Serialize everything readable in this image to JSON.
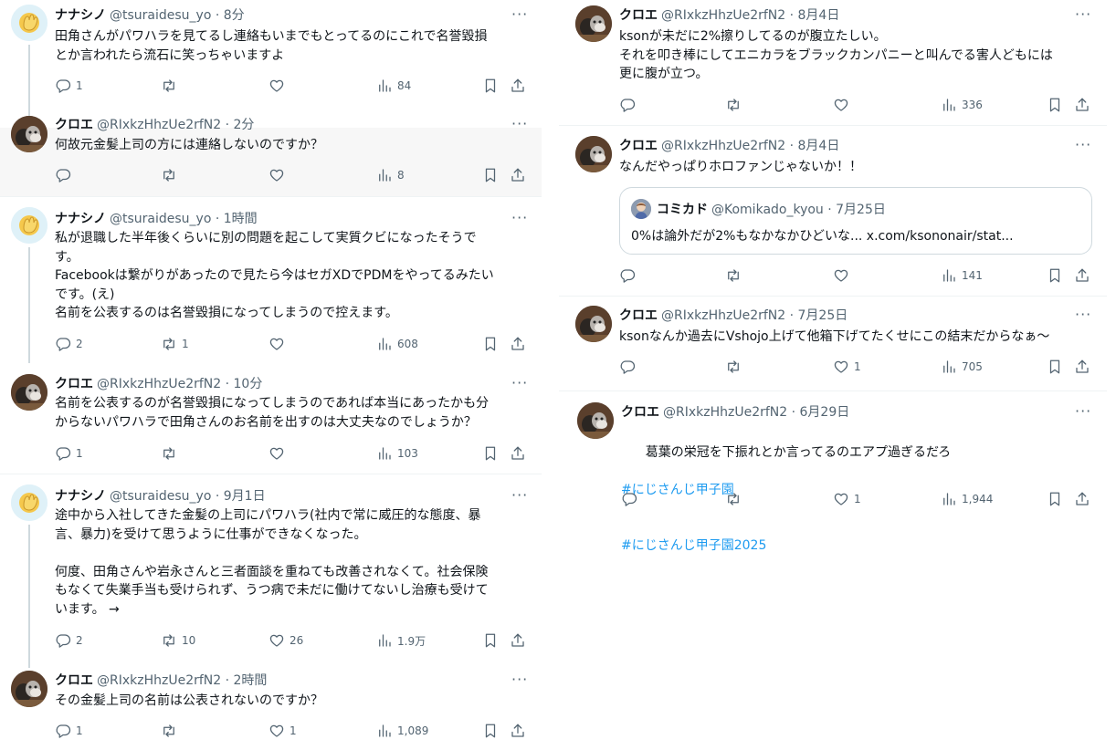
{
  "colors": {
    "accent": "#1d9bf0",
    "text": "#0f1419",
    "muted": "#536471",
    "border": "#eff3f4"
  },
  "icons": [
    "reply-icon",
    "retweet-icon",
    "like-icon",
    "views-icon",
    "bookmark-icon",
    "share-icon",
    "more-icon"
  ],
  "left": {
    "t1": {
      "name": "ナナシノ",
      "handle": "@tsuraidesu_yo · 8分",
      "text": "田角さんがパワハラを見てるし連絡もいまでもとってるのにこれで名誉毀損\nとか言われたら流石に笑っちゃいますよ",
      "replies": "1",
      "retweets": "",
      "likes": "",
      "views": "84"
    },
    "t2": {
      "name": "クロエ",
      "handle": "@RIxkzHhzUe2rfN2 · 2分",
      "text": "何故元金髪上司の方には連絡しないのですか？",
      "replies": "",
      "retweets": "",
      "likes": "",
      "views": "8"
    },
    "t3": {
      "name": "ナナシノ",
      "handle": "@tsuraidesu_yo · 1時間",
      "text": "私が退職した半年後くらいに別の問題を起こして実質クビになったそうで\nす。\nFacebookは繋がりがあったので見たら今はセガXDでPDMをやってるみたい\nです。(え)\n名前を公表するのは名誉毀損になってしまうので控えます。",
      "replies": "2",
      "retweets": "1",
      "likes": "",
      "views": "608"
    },
    "t4": {
      "name": "クロエ",
      "handle": "@RIxkzHhzUe2rfN2 · 10分",
      "text": "名前を公表するのが名誉毀損になってしまうのであれば本当にあったかも分\nからないパワハラで田角さんのお名前を出すのは大丈夫なのでしょうか？",
      "replies": "1",
      "retweets": "",
      "likes": "",
      "views": "103"
    },
    "t5": {
      "name": "ナナシノ",
      "handle": "@tsuraidesu_yo · 9月1日",
      "text": "途中から入社してきた金髪の上司にパワハラ(社内で常に威圧的な態度、暴\n言、暴力)を受けて思うように仕事ができなくなった。\n\n何度、田角さんや岩永さんと三者面談を重ねても改善されなくて。社会保険\nもなくて失業手当も受けられず、うつ病で未だに働けてないし治療も受けて\nいます。 →",
      "replies": "2",
      "retweets": "10",
      "likes": "26",
      "views": "1.9万"
    },
    "t6": {
      "name": "クロエ",
      "handle": "@RIxkzHhzUe2rfN2 · 2時間",
      "text": "その金髪上司の名前は公表されないのですか？",
      "replies": "1",
      "retweets": "",
      "likes": "1",
      "views": "1,089"
    }
  },
  "right": {
    "t1": {
      "name": "クロエ",
      "handle": "@RIxkzHhzUe2rfN2 · 8月4日",
      "text": "ksonが未だに2%擦りしてるのが腹立たしい。\nそれを叩き棒にしてエニカラをブラックカンパニーと叫んでる害人どもには\n更に腹が立つ。",
      "replies": "",
      "retweets": "",
      "likes": "",
      "views": "336"
    },
    "t2": {
      "name": "クロエ",
      "handle": "@RIxkzHhzUe2rfN2 · 8月4日",
      "text": "なんだやっぱりホロファンじゃないか！！",
      "quote": {
        "name": "コミカド",
        "handle": "@Komikado_kyou · 7月25日",
        "text": "0%は論外だが2%もなかなかひどいな... x.com/ksononair/stat..."
      },
      "replies": "",
      "retweets": "",
      "likes": "",
      "views": "141"
    },
    "t3": {
      "name": "クロエ",
      "handle": "@RIxkzHhzUe2rfN2 · 7月25日",
      "text": "ksonなんか過去にVshojo上げて他箱下げてたくせにこの結末だからなぁ～",
      "replies": "",
      "retweets": "",
      "likes": "1",
      "views": "705"
    },
    "t4": {
      "name": "クロエ",
      "handle": "@RIxkzHhzUe2rfN2 · 6月29日",
      "text": "葛葉の栄冠を下振れとか言ってるのエアプ過ぎるだろ",
      "tags": [
        "#にじさんじ甲子園",
        "#にじさんじ甲子園2025"
      ],
      "replies": "",
      "retweets": "",
      "likes": "1",
      "views": "1,944"
    }
  }
}
